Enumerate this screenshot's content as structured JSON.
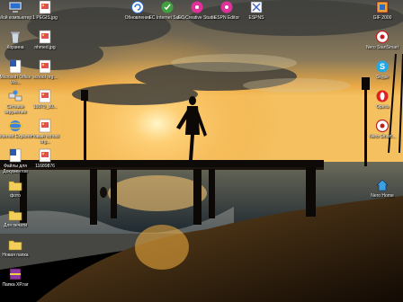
{
  "desktop": {
    "icons": [
      {
        "label": "Мой компьютер",
        "icon": "computer-icon"
      },
      {
        "label": "1 PEGIS.jpg",
        "icon": "image-file-icon"
      },
      {
        "label": "Обновления",
        "icon": "update-icon"
      },
      {
        "label": "EC Internet Safety",
        "icon": "internet-safety-icon"
      },
      {
        "label": "EC Creative Studio",
        "icon": "creative-studio-icon"
      },
      {
        "label": "ESPN Editor",
        "icon": "espn-editor-icon"
      },
      {
        "label": "ESPNS",
        "icon": "espns-icon"
      },
      {
        "label": "GIF 2000",
        "icon": "gif-2000-icon"
      },
      {
        "label": "Корзина",
        "icon": "recycle-bin-icon"
      },
      {
        "label": "nhmed.jpg",
        "icon": "image-file-icon"
      },
      {
        "label": "Nero StartSmart",
        "icon": "nero-icon"
      },
      {
        "label": "Microsoft Office Wo...",
        "icon": "word-icon"
      },
      {
        "label": "school org...",
        "icon": "image-file-icon"
      },
      {
        "label": "Skype",
        "icon": "skype-icon"
      },
      {
        "label": "Сетевое окружение",
        "icon": "network-icon"
      },
      {
        "label": "16079_80...",
        "icon": "image-file-icon"
      },
      {
        "label": "Opera",
        "icon": "opera-icon"
      },
      {
        "label": "Internet Explorer",
        "icon": "internet-explorer-icon"
      },
      {
        "label": "Новый school org...",
        "icon": "image-file-icon"
      },
      {
        "label": "Nero Smart...",
        "icon": "nero-icon"
      },
      {
        "label": "Файлы для Документов",
        "icon": "word-icon"
      },
      {
        "label": "11689876",
        "icon": "image-file-icon"
      },
      {
        "label": "Nero Home",
        "icon": "nero-home-icon"
      },
      {
        "label": "фото",
        "icon": "folder-icon"
      },
      {
        "label": "Для печати",
        "icon": "folder-icon"
      },
      {
        "label": "Новая папка",
        "icon": "folder-icon"
      },
      {
        "label": "Папка XP.rar",
        "icon": "archive-icon"
      }
    ]
  },
  "colors": {
    "sky_top": "#5a5a55",
    "sky_glow": "#f2b040",
    "water": "#3a4a55",
    "sand": "#3a2410"
  }
}
